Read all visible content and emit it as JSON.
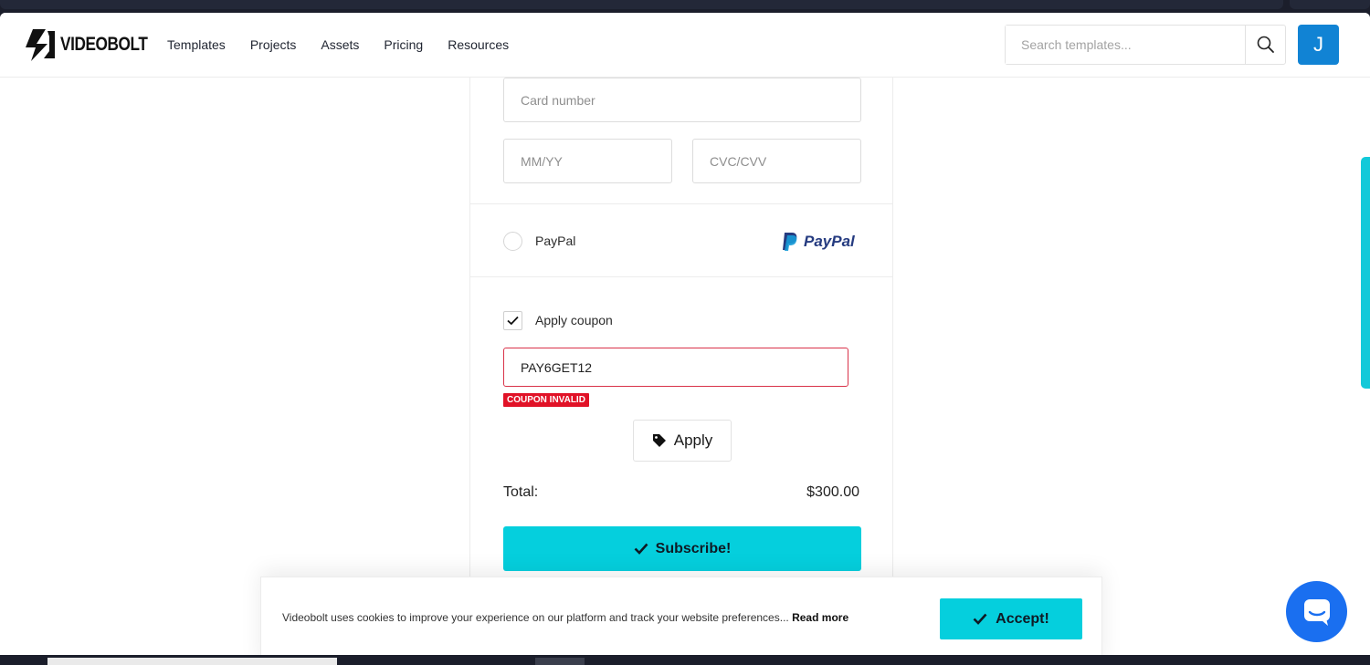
{
  "header": {
    "brand": "VIDEOBOLT",
    "nav": [
      "Templates",
      "Projects",
      "Assets",
      "Pricing",
      "Resources"
    ],
    "search_placeholder": "Search templates...",
    "avatar_initial": "J"
  },
  "payment": {
    "card_number_placeholder": "Card number",
    "expiry_placeholder": "MM/YY",
    "cvc_placeholder": "CVC/CVV",
    "paypal_label": "PayPal",
    "paypal_logo_text": "PayPal",
    "coupon_checkbox_label": "Apply coupon",
    "coupon_value": "PAY6GET12",
    "coupon_error": "COUPON INVALID",
    "apply_label": "Apply",
    "total_label": "Total:",
    "total_value": "$300.00",
    "subscribe_label": "Subscribe!"
  },
  "cookie": {
    "text": "Videobolt uses cookies to improve your experience on our platform and track your website preferences...",
    "read_more": "Read more",
    "accept_label": "Accept!"
  },
  "colors": {
    "accent": "#05cfdd",
    "avatar": "#1183d4",
    "error": "#e11227",
    "chat": "#1a6ff0"
  }
}
